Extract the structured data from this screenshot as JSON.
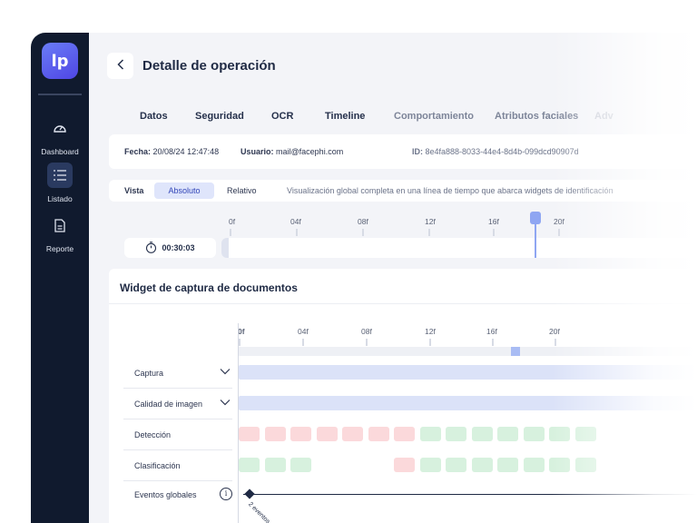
{
  "sidebar": {
    "logo": "lp",
    "items": [
      {
        "label": "Dashboard",
        "icon": "gauge-icon"
      },
      {
        "label": "Listado",
        "icon": "list-icon"
      },
      {
        "label": "Reporte",
        "icon": "document-icon"
      }
    ]
  },
  "header": {
    "title": "Detalle de operación"
  },
  "tabs": [
    "Datos",
    "Seguridad",
    "OCR",
    "Timeline",
    "Comportamiento",
    "Atributos faciales",
    "Adv"
  ],
  "info": {
    "fecha_label": "Fecha:",
    "fecha_value": "20/08/24 12:47:48",
    "usuario_label": "Usuario:",
    "usuario_value": "mail@facephi.com",
    "id_label": "ID:",
    "id_value": "8e4fa888-8033-44e4-8d4b-099dcd90907d"
  },
  "view": {
    "label": "Vista",
    "options": [
      "Absoluto",
      "Relativo"
    ],
    "selected": "Absoluto",
    "description": "Visualización global completa en una línea de tiempo que abarca widgets de identificación"
  },
  "timeline_top": {
    "ticks": [
      "0f",
      "04f",
      "08f",
      "12f",
      "16f",
      "20f"
    ],
    "duration": "00:30:03",
    "marker_fraction": 0.67
  },
  "widget": {
    "title": "Widget de captura de documentos",
    "ticks": [
      "0f",
      "04f",
      "08f",
      "12f",
      "16f",
      "20f"
    ],
    "rows": [
      {
        "label": "Captura",
        "expandable": true
      },
      {
        "label": "Calidad de imagen",
        "expandable": true
      },
      {
        "label": "Detección",
        "expandable": false
      },
      {
        "label": "Clasificación",
        "expandable": false
      },
      {
        "label": "Eventos globales",
        "expandable": false
      }
    ],
    "deteccion_cells": [
      "red",
      "red",
      "red",
      "red",
      "red",
      "red",
      "red",
      "green",
      "green",
      "green",
      "green",
      "green",
      "green",
      "green"
    ],
    "clasificacion_cells": [
      "green",
      "green",
      "green",
      "empty",
      "empty",
      "empty",
      "red",
      "green",
      "green",
      "green",
      "green",
      "green",
      "green",
      "green"
    ],
    "events_label": "2 eventos",
    "info_glyph": "i"
  },
  "colors": {
    "sidebar": "#101a2e",
    "accent": "#4f46e5",
    "error": "#fbd9db",
    "ok": "#d7f1de"
  }
}
